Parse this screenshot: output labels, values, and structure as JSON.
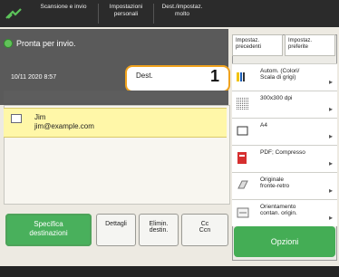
{
  "tabs": [
    "Scansione e\ninvio",
    "Impostazioni\npersonali",
    "Dest./impostaz.\nmolto"
  ],
  "status": "Pronta per invio.",
  "datetime": "10/11 2020 8:57",
  "dest": {
    "label": "Dest.",
    "count": "1"
  },
  "recipient": {
    "name": "Jim",
    "email": "jim@example.com"
  },
  "buttons": {
    "specify": "Specifica\ndestinazioni",
    "details": "Dettagli",
    "delete": "Elimin.\ndestin.",
    "cc": "Cc\nCcn"
  },
  "side_top": [
    "Impostaz.\nprecedenti",
    "Impostaz.\npreferite"
  ],
  "options": [
    {
      "text": "Autom. (Colori/\nScala di grigi)"
    },
    {
      "text": "300x300 dpi"
    },
    {
      "text": "A4"
    },
    {
      "text": "PDF; Compresso"
    },
    {
      "text": "Originale\nfronte-retro"
    },
    {
      "text": "Orientamento\ncontan. origin."
    }
  ],
  "options_button": "Opzioni"
}
